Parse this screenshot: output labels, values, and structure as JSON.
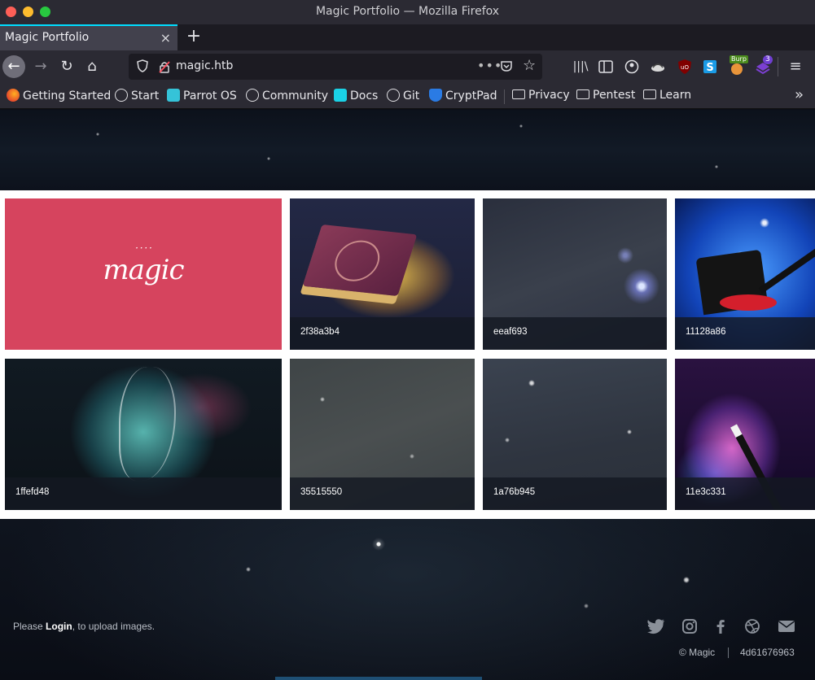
{
  "window": {
    "title": "Magic Portfolio — Mozilla Firefox"
  },
  "tabs": [
    {
      "label": "Magic Portfolio",
      "close": "×"
    }
  ],
  "new_tab": "+",
  "navbar": {
    "back": "←",
    "forward": "→",
    "reload": "↻",
    "home": "⌂",
    "url": "magic.htb",
    "more": "•••",
    "star": "☆"
  },
  "toolbar": {
    "library": "|||\\",
    "burp_label": "Burp",
    "ext_badge": "3",
    "menu": "≡"
  },
  "bookmarks": [
    {
      "label": "Getting Started",
      "icon": "firefox-icon"
    },
    {
      "label": "Start",
      "icon": "globe-icon"
    },
    {
      "label": "Parrot OS",
      "icon": "parrot-icon"
    },
    {
      "label": "Community",
      "icon": "globe-icon"
    },
    {
      "label": "Docs",
      "icon": "docs-icon"
    },
    {
      "label": "Git",
      "icon": "globe-icon"
    },
    {
      "label": "CryptPad",
      "icon": "cryptpad-icon"
    },
    {
      "label": "Privacy",
      "icon": "folder-icon"
    },
    {
      "label": "Pentest",
      "icon": "folder-icon"
    },
    {
      "label": "Learn",
      "icon": "folder-icon"
    }
  ],
  "bookmarks_overflow": "»",
  "gallery": {
    "logo_text": "magic",
    "images": [
      {
        "caption": "2f38a3b4"
      },
      {
        "caption": "eeaf693"
      },
      {
        "caption": "11128a86"
      },
      {
        "caption": "1ffefd48"
      },
      {
        "caption": "35515550"
      },
      {
        "caption": "1a76b945"
      },
      {
        "caption": "11e3c331"
      }
    ]
  },
  "footer": {
    "prefix": "Please ",
    "login": "Login",
    "suffix": ", to upload images.",
    "copyright": "© Magic",
    "hash": "4d61676963",
    "social": [
      "twitter-icon",
      "instagram-icon",
      "facebook-icon",
      "dribbble-icon",
      "envelope-icon"
    ]
  },
  "colors": {
    "logo_background": "#d6445e",
    "tab_accent": "#00ddff"
  }
}
